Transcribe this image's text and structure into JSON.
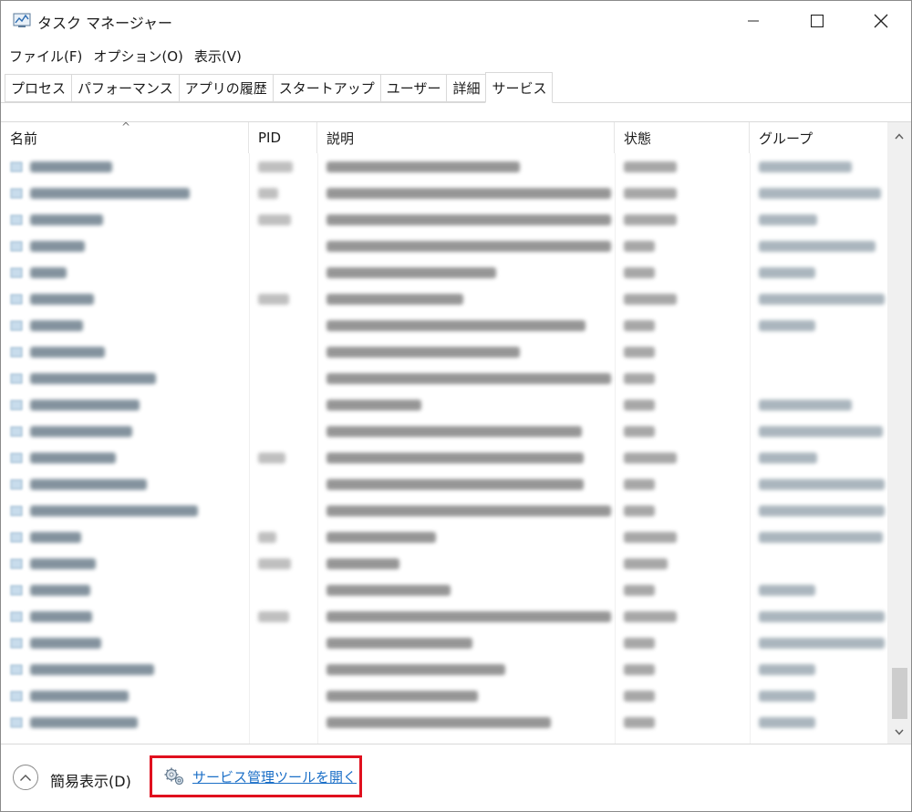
{
  "window": {
    "title": "タスク マネージャー"
  },
  "menu": [
    "ファイル(F)",
    "オプション(O)",
    "表示(V)"
  ],
  "tabs": [
    {
      "label": "プロセス"
    },
    {
      "label": "パフォーマンス"
    },
    {
      "label": "アプリの履歴"
    },
    {
      "label": "スタートアップ"
    },
    {
      "label": "ユーザー"
    },
    {
      "label": "詳細"
    },
    {
      "label": "サービス",
      "active": true
    }
  ],
  "table": {
    "columns": [
      "名前",
      "PID",
      "説明",
      "状態",
      "グループ"
    ],
    "sorted_by": "名前",
    "row_count": 22
  },
  "footer": {
    "fewer_details": "簡易表示(D)",
    "open_services": "サービス管理ツールを開く"
  },
  "colors": {
    "highlight_border": "#e0101e",
    "link": "#1b6fc7"
  }
}
